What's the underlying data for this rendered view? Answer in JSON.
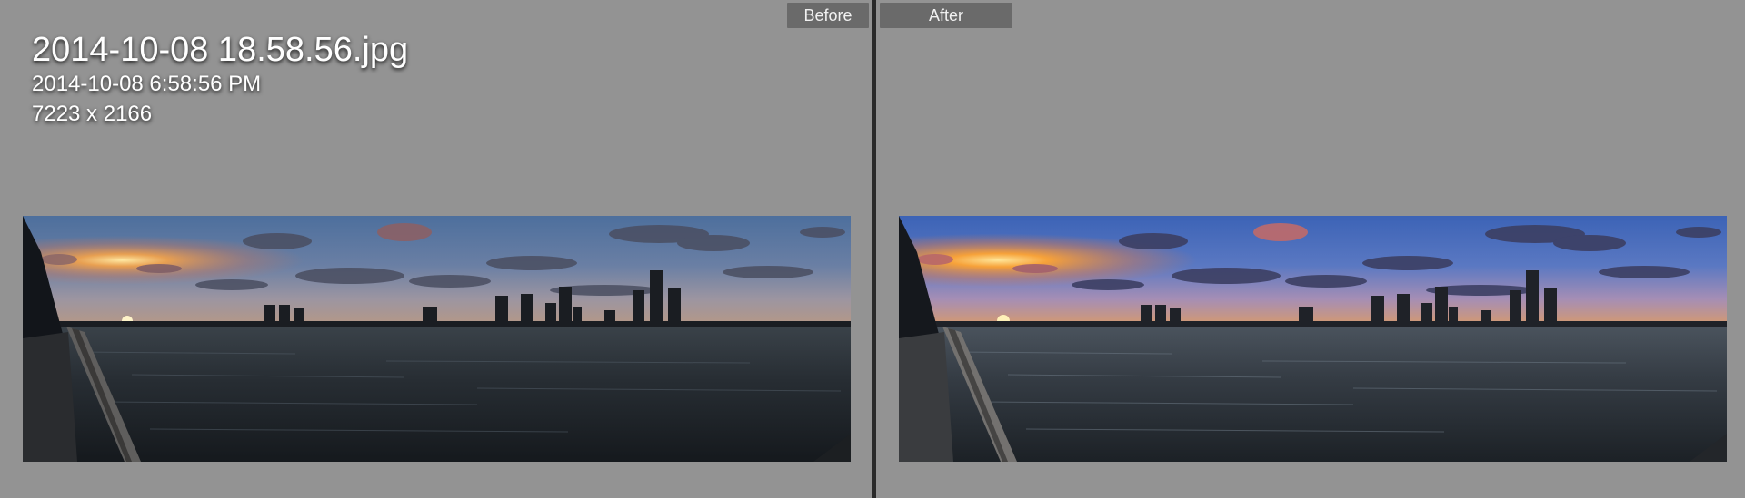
{
  "app": {
    "view_mode": "before-after-side-by-side"
  },
  "header": {
    "before_label": "Before",
    "after_label": "After"
  },
  "image_info": {
    "filename": "2014-10-08 18.58.56.jpg",
    "capture_time": "2014-10-08 6:58:56 PM",
    "dimensions": "7223 x 2166"
  },
  "colors": {
    "background": "#939393",
    "divider": "#2a2a2a",
    "label_bg": "#6a6a6a",
    "label_text": "#f1f1f1",
    "info_text": "#ffffff"
  },
  "photos": {
    "before": {
      "subject": "sunset-city-skyline-river-panorama",
      "grade": "original"
    },
    "after": {
      "subject": "sunset-city-skyline-river-panorama",
      "grade": "enhanced"
    }
  }
}
